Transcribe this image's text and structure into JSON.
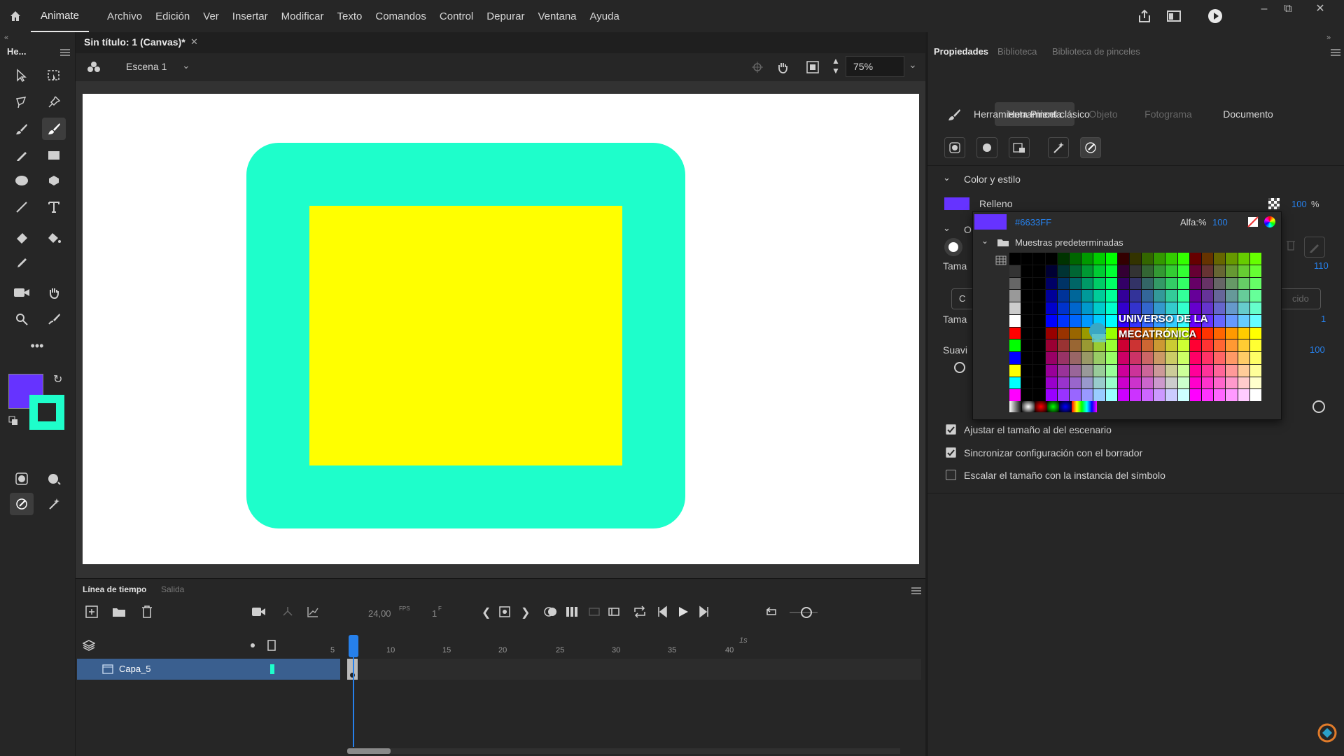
{
  "menubar": {
    "app": "Animate",
    "items": [
      "Archivo",
      "Edición",
      "Ver",
      "Insertar",
      "Modificar",
      "Texto",
      "Comandos",
      "Control",
      "Depurar",
      "Ventana",
      "Ayuda"
    ]
  },
  "toolbar": {
    "header": "He..."
  },
  "document": {
    "tab_title": "Sin título: 1 (Canvas)*",
    "scene": "Escena 1",
    "zoom": "75%"
  },
  "stage": {
    "outer_color": "#1efecb",
    "inner_color": "#ffff00"
  },
  "timeline": {
    "tabs": [
      "Línea de tiempo",
      "Salida"
    ],
    "fps": "24,00",
    "fps_unit": "FPS",
    "frame": "1",
    "frame_unit": "F",
    "seconds_mark": "1s",
    "ruler": [
      "5",
      "10",
      "15",
      "20",
      "25",
      "30",
      "35",
      "40"
    ],
    "layer": "Capa_5"
  },
  "panel": {
    "tabs": [
      "Propiedades",
      "Biblioteca",
      "Biblioteca de pinceles"
    ],
    "segments": [
      "Herramienta",
      "Objeto",
      "Fotograma",
      "Documento"
    ],
    "tool_name": "Herramienta Pincel clásico",
    "section_color": "Color y estilo",
    "fill_label": "Relleno",
    "fill_color": "#6633FF",
    "fill_percent": "100",
    "percent_sign": "%",
    "section2_partial": "O",
    "size_label_partial": "Tama",
    "size_value": "110",
    "size2_label_partial": "Tama",
    "size2_value": "1",
    "smooth_label_partial": "Suavi",
    "smooth_value": "100",
    "btn_partial_left": "C",
    "btn_partial_right": "cido",
    "checkboxes": [
      {
        "label": "Ajustar el tamaño al del escenario",
        "checked": true
      },
      {
        "label": "Sincronizar configuración con el borrador",
        "checked": true
      },
      {
        "label": "Escalar el tamaño con la instancia del símbolo",
        "checked": false
      }
    ]
  },
  "swatch_popup": {
    "hex": "#6633FF",
    "alpha_label": "Alfa:%",
    "alpha_value": "100",
    "folder": "Muestras predeterminadas",
    "watermark_line1": "UNIVERSO DE LA",
    "watermark_line2": "MECATRÓNICA"
  },
  "colors": {
    "fill": "#6633ff",
    "stroke": "#1efecb",
    "accent": "#2680eb"
  }
}
